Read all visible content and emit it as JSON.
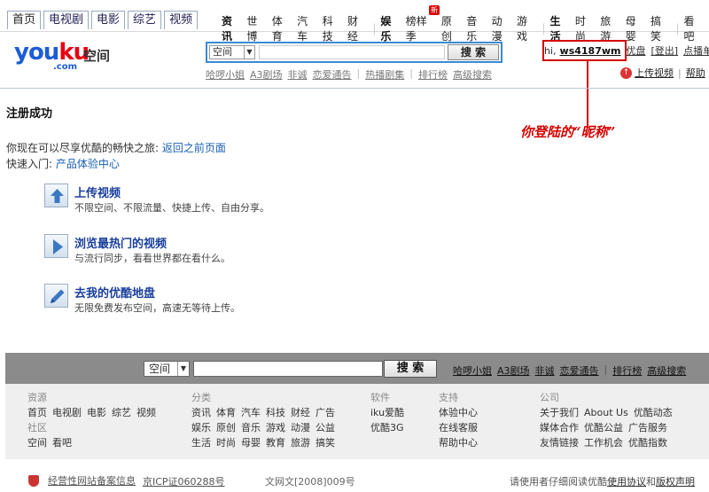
{
  "topnav": {
    "tabs": [
      "首页",
      "电视剧",
      "电影",
      "综艺",
      "视频"
    ],
    "groups": [
      {
        "label": "资讯",
        "links": [
          "世博",
          "体育",
          "汽车",
          "科技",
          "财经"
        ]
      },
      {
        "label": "娱乐",
        "links": [
          "榜样季",
          "原创",
          "音乐",
          "动漫",
          "游戏"
        ]
      },
      {
        "label": "生活",
        "links": [
          "时尚",
          "旅游",
          "母婴",
          "搞笑"
        ]
      },
      {
        "label": "",
        "links": [
          "看吧"
        ]
      }
    ],
    "new_badge": "新"
  },
  "header": {
    "logo_you": "you",
    "logo_ku": "ku",
    "logo_com": ".com",
    "logo_space": "空间",
    "search_select": "空间",
    "search_button": "搜 索",
    "sublinks": [
      "哈啰小姐",
      "A3剧场",
      "非诚",
      "恋爱通告",
      "热播剧集",
      "排行榜",
      "高级搜索"
    ]
  },
  "userbar": {
    "hi": "hi,",
    "nickname": "ws4187wm",
    "links": [
      "优盘",
      "[登出]",
      "点播单"
    ],
    "upload": "上传视频",
    "help": "帮助"
  },
  "annotation": "你登陆的“昵称”",
  "main": {
    "title": "注册成功",
    "line1_prefix": "你现在可以尽享优酷的畅快之旅:",
    "line1_link": "返回之前页面",
    "line2_prefix": "快速入门:",
    "line2_link": "产品体验中心",
    "features": [
      {
        "title": "上传视频",
        "desc": "不限空间、不限流量、快捷上传、自由分享。",
        "icon": "upload-arrow-icon"
      },
      {
        "title": "浏览最热门的视频",
        "desc": "与流行同步，看看世界都在看什么。",
        "icon": "play-icon"
      },
      {
        "title": "去我的优酷地盘",
        "desc": "无限免费发布空间，高速无等待上传。",
        "icon": "pencil-icon"
      }
    ]
  },
  "footer": {
    "search_select": "空间",
    "search_button": "搜 索",
    "links": [
      "哈啰小姐",
      "A3剧场",
      "非诚",
      "恋爱通告",
      "排行榜",
      "高级搜索"
    ],
    "resources": {
      "head": "资源",
      "row1": [
        "首页",
        "电视剧",
        "电影",
        "综艺",
        "视频"
      ],
      "head2": "社区",
      "row2": [
        "空间",
        "看吧"
      ]
    },
    "categories": {
      "head": "分类",
      "row1": [
        "资讯",
        "体育",
        "汽车",
        "科技",
        "财经",
        "广告"
      ],
      "row2": [
        "娱乐",
        "原创",
        "音乐",
        "游戏",
        "动漫",
        "公益"
      ],
      "row3": [
        "生活",
        "时尚",
        "母婴",
        "教育",
        "旅游",
        "搞笑"
      ]
    },
    "software": {
      "head": "软件",
      "row1": [
        "iku爱酷"
      ],
      "row2": [
        "优酷3G"
      ]
    },
    "support": {
      "head": "支持",
      "row1": [
        "体验中心"
      ],
      "row2": [
        "在线客服"
      ],
      "row3": [
        "帮助中心"
      ]
    },
    "company": {
      "head": "公司",
      "row1": [
        "关于我们",
        "About Us",
        "优酷动态"
      ],
      "row2": [
        "媒体合作",
        "优酷公益",
        "广告服务"
      ],
      "row3": [
        "友情链接",
        "工作机会",
        "优酷指数"
      ]
    }
  },
  "bottom": {
    "filing": "经营性网站备案信息",
    "icp": "京ICP证060288号",
    "wenwang": "文网文[2008]009号",
    "notice_prefix": "请使用者仔细阅读优酷",
    "agreement": "使用协议",
    "and": "和",
    "copyright": "版权声明"
  },
  "colors": {
    "accent": "#1a5fb4",
    "annotation": "#d40000",
    "footer_bar": "#8b8b8b"
  }
}
